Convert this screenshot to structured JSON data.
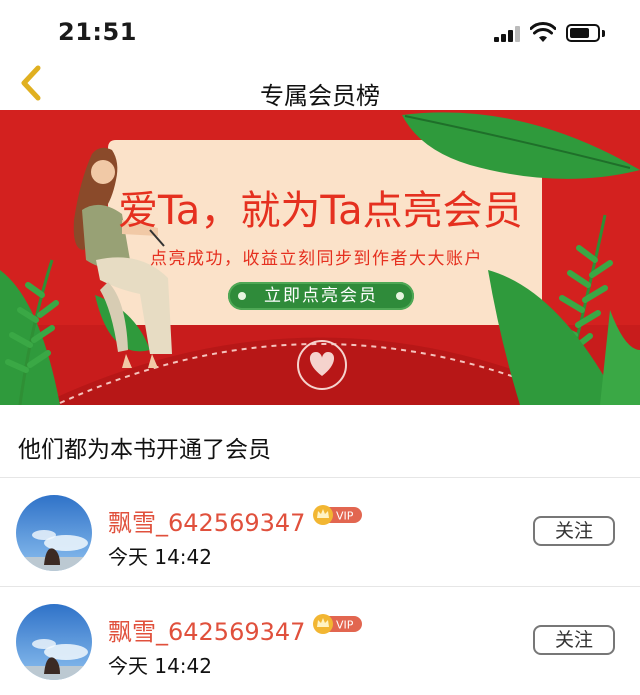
{
  "status_bar": {
    "time": "21:51"
  },
  "nav": {
    "title": "专属会员榜",
    "back_icon": "chevron-left-icon"
  },
  "banner": {
    "headline": "爱Ta，就为Ta点亮会员",
    "subtitle": "点亮成功，收益立刻同步到作者大大账户",
    "button_label": "立即点亮会员"
  },
  "section": {
    "title": "他们都为本书开通了会员"
  },
  "members": [
    {
      "name": "飘雪_642569347",
      "badge": "VIP",
      "time": "今天 14:42",
      "follow_label": "关注"
    },
    {
      "name": "飘雪_642569347",
      "badge": "VIP",
      "time": "今天 14:42",
      "follow_label": "关注"
    }
  ],
  "colors": {
    "banner_red": "#d3211f",
    "accent_green": "#2f8b3a",
    "name_red": "#e0503c",
    "back_yellow": "#e0b020"
  }
}
